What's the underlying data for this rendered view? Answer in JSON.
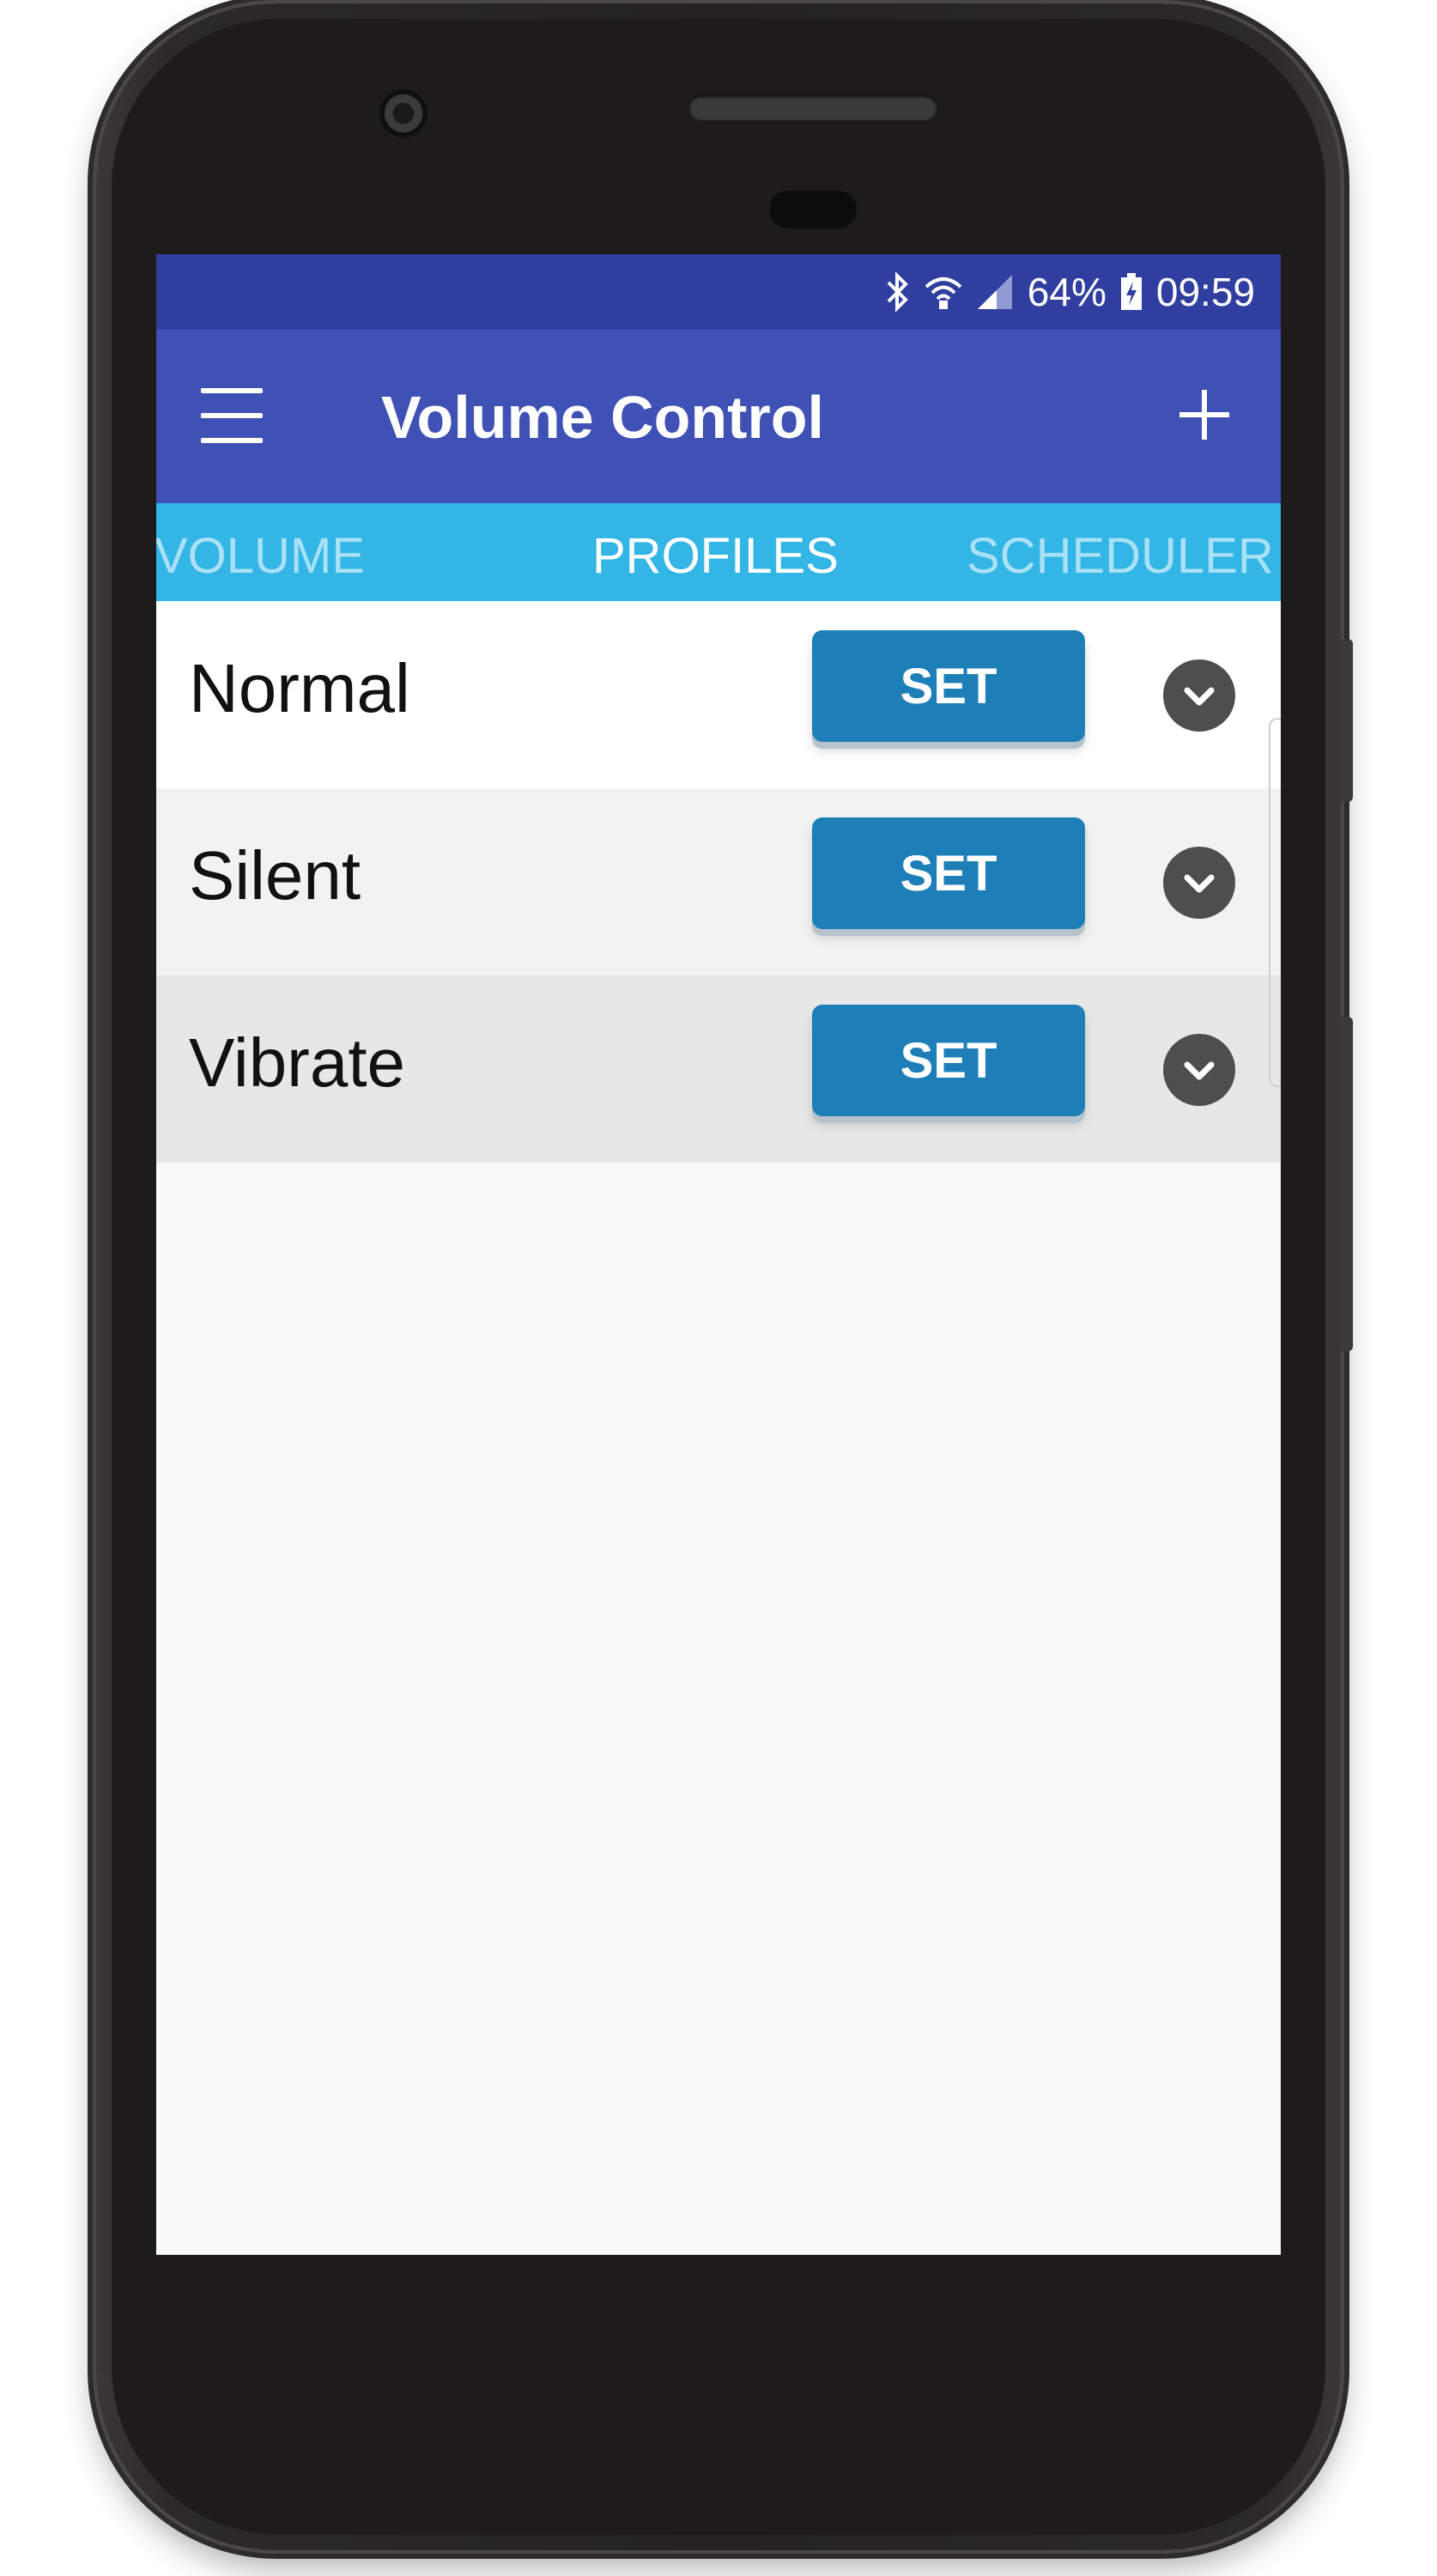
{
  "status_bar": {
    "battery": "64%",
    "time": "09:59",
    "icons": [
      "bluetooth-icon",
      "wifi-icon",
      "signal-icon",
      "battery-charging-icon"
    ]
  },
  "app_bar": {
    "title": "Volume Control",
    "menu_icon": "hamburger-menu-icon",
    "add_icon": "plus-icon",
    "color": "#3f51b5",
    "status_color": "#303f9f"
  },
  "tabs": [
    {
      "label": "VOLUME"
    },
    {
      "label": "PROFILES",
      "selected": true
    },
    {
      "label": "SCHEDULER"
    }
  ],
  "tab_bar_color": "#33b5e5",
  "profiles": [
    {
      "name": "Normal",
      "button": "SET"
    },
    {
      "name": "Silent",
      "button": "SET"
    },
    {
      "name": "Vibrate",
      "button": "SET"
    }
  ],
  "accent": "#1e7fb8"
}
